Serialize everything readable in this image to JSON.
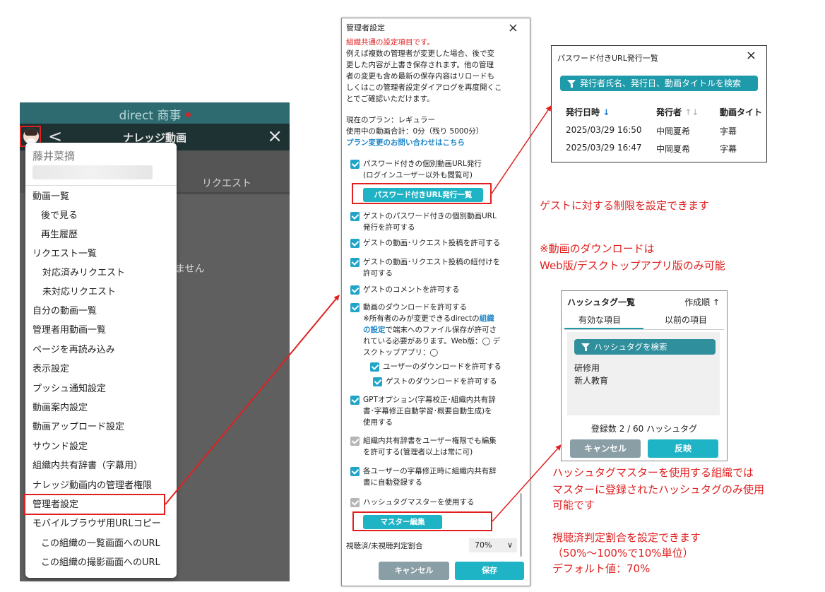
{
  "phone": {
    "brand": "direct 商事",
    "nav_title": "ナレッジ動画",
    "back_icon": "<",
    "close_icon": "×",
    "bg_tab": "リクエスト",
    "bg_empty": "ません",
    "user_name": "藤井菜摘",
    "menu_items": [
      "動画一覧",
      "後で見る",
      "再生履歴",
      "リクエスト一覧",
      "対応済みリクエスト",
      "未対応リクエスト",
      "自分の動画一覧",
      "管理者用動画一覧",
      "ページを再読み込み",
      "表示設定",
      "プッシュ通知設定",
      "動画案内設定",
      "動画アップロード設定",
      "サウンド設定",
      "組織内共有辞書（字幕用）",
      "ナレッジ動画内の管理者権限",
      "管理者設定",
      "モバイルブラウザ用URLコピー",
      "この組織の一覧画面へのURL",
      "この組織の撮影画面へのURL"
    ]
  },
  "dialog": {
    "title": "管理者設定",
    "close": "×",
    "notice": "組織共通の設定項目です。",
    "desc": [
      "例えば複数の管理者が変更した場合、後で変",
      "更した内容が上書き保存されます。他の管理",
      "者の変更も含め最新の保存内容はリロードも",
      "しくはこの管理者設定ダイアログを再度開くこ",
      "とでご確認いただけます。"
    ],
    "plan": "現在のプラン：レギュラー",
    "usage": "使用中の動画合計：0分（残り 5000分）",
    "plan_link": "プラン変更のお問い合わせはこちら",
    "opt_password": [
      "パスワード付きの個別動画URL発行",
      "(ログインユーザー以外も閲覧可)"
    ],
    "btn_pw_list": "パスワード付きURL発行一覧",
    "opt_guest_pw": [
      "ゲストのパスワード付きの個別動画URL",
      "発行を許可する"
    ],
    "opt_guest_post": "ゲストの動画･リクエスト投稿を許可する",
    "opt_guest_link": [
      "ゲストの動画･リクエスト投稿の紐付けを",
      "許可する"
    ],
    "opt_guest_comment": "ゲストのコメントを許可する",
    "opt_download": "動画のダウンロードを許可する",
    "dl_note_a": "※所有者のみが変更できるdirectの",
    "dl_note_link1": "組織",
    "dl_note_link2": "の設定",
    "dl_note_b": "で端末へのファイル保存が許可さ",
    "dl_note_c": "れている必要があります。Web版：◯ デ",
    "dl_note_d": "スクトップアプリ：◯",
    "opt_user_dl": "ユーザーのダウンロードを許可する",
    "opt_guest_dl": "ゲストのダウンロードを許可する",
    "opt_gpt": [
      "GPTオプション(字幕校正･組織内共有辞",
      "書･字幕修正自動学習･概要自動生成)を",
      "使用する"
    ],
    "opt_dict_edit": [
      "組織内共有辞書をユーザー権限でも編集",
      "を許可する(管理者以上は常に可)"
    ],
    "opt_auto_reg": [
      "各ユーザーの字幕修正時に組織内共有辞",
      "書に自動登録する"
    ],
    "opt_hashtag": "ハッシュタグマスターを使用する",
    "btn_master": "マスター編集",
    "ratio_label": "視聴済/未視聴判定割合",
    "ratio_value": "70%",
    "btn_cancel": "キャンセル",
    "btn_save": "保存"
  },
  "pw_panel": {
    "title": "パスワード付きURL発行一覧",
    "close": "×",
    "search": "発行者氏名、発行日、動画タイトルを検索",
    "col_date": "発行日時",
    "col_date_sort": "↓",
    "col_issuer": "発行者",
    "col_issuer_sort": "↑↓",
    "col_title": "動画タイト",
    "rows": [
      {
        "date": "2025/03/29 16:50",
        "issuer": "中岡夏希",
        "title": "字幕"
      },
      {
        "date": "2025/03/29 16:47",
        "issuer": "中岡夏希",
        "title": "字幕"
      }
    ]
  },
  "hashtag_panel": {
    "title": "ハッシュタグ一覧",
    "sort": "作成順 ↑",
    "tab_active": "有効な項目",
    "tab_prev": "以前の項目",
    "search": "ハッシュタグを検索",
    "tags": [
      "研修用",
      "新人教育"
    ],
    "count": "登録数 2 / 60 ハッシュタグ",
    "btn_cancel": "キャンセル",
    "btn_apply": "反映"
  },
  "notes": {
    "guest": "ゲストに対する制限を設定できます",
    "download": [
      "※動画のダウンロードは",
      "Web版/デスクトップアプリ版のみ可能"
    ],
    "hashtag": [
      "ハッシュタグマスターを使用する組織では",
      "マスターに登録されたハッシュタグのみ使用",
      "可能です"
    ],
    "ratio": [
      "視聴済判定割合を設定できます",
      "（50%～100%で10%単位）",
      "デフォルト値：70%"
    ]
  },
  "colors": {
    "accent": "#1fb3c6",
    "highlight": "#e02020",
    "note": "#e02020",
    "phone_header": "#2e6b70"
  }
}
